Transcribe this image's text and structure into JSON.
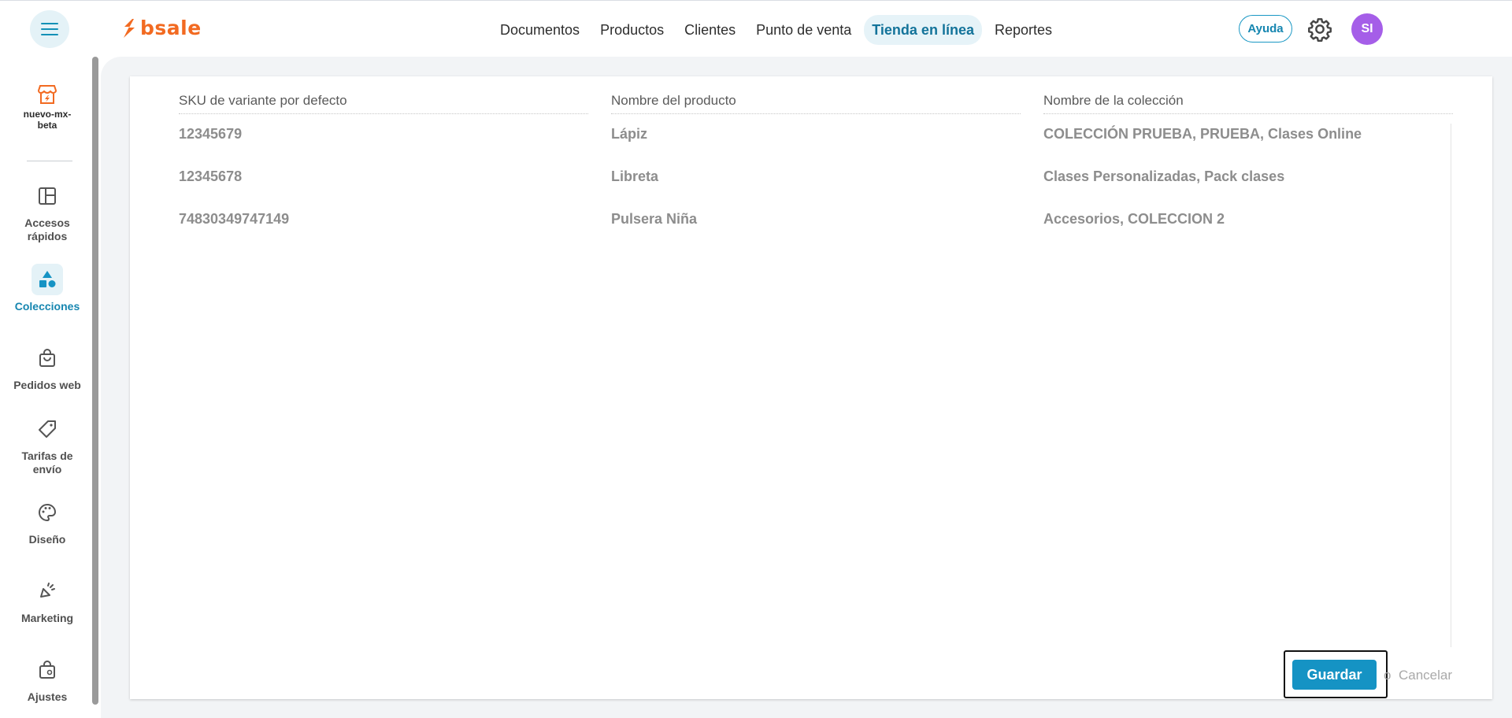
{
  "header": {
    "logo_text": "bsale",
    "nav": [
      {
        "label": "Documentos",
        "active": false
      },
      {
        "label": "Productos",
        "active": false
      },
      {
        "label": "Clientes",
        "active": false
      },
      {
        "label": "Punto de venta",
        "active": false
      },
      {
        "label": "Tienda en línea",
        "active": true
      },
      {
        "label": "Reportes",
        "active": false
      }
    ],
    "help_label": "Ayuda",
    "avatar_initials": "SI",
    "colors": {
      "brand": "#f26a21",
      "accent": "#1593c4",
      "avatar": "#a55ee8"
    }
  },
  "sidebar": {
    "store_name": "nuevo-mx-beta",
    "items": [
      {
        "label": "Accesos rápidos",
        "icon": "layout-icon",
        "active": false
      },
      {
        "label": "Colecciones",
        "icon": "shapes-icon",
        "active": true
      },
      {
        "label": "Pedidos web",
        "icon": "shopping-bag-icon",
        "active": false
      },
      {
        "label": "Tarifas de envío",
        "icon": "tag-icon",
        "active": false
      },
      {
        "label": "Diseño",
        "icon": "palette-icon",
        "active": false
      },
      {
        "label": "Marketing",
        "icon": "megaphone-icon",
        "active": false
      },
      {
        "label": "Ajustes",
        "icon": "bag-settings-icon",
        "active": false
      }
    ]
  },
  "table": {
    "columns": [
      "SKU de variante por defecto",
      "Nombre del producto",
      "Nombre de la colección"
    ],
    "rows": [
      [
        "12345679",
        "Lápiz",
        "COLECCIÓN PRUEBA, PRUEBA, Clases Online"
      ],
      [
        "12345678",
        "Libreta",
        "Clases Personalizadas, Pack clases"
      ],
      [
        "74830349747149",
        "Pulsera Niña",
        "Accesorios, COLECCION 2"
      ]
    ]
  },
  "actions": {
    "save_label": "Guardar",
    "or_label": "o",
    "cancel_label": "Cancelar"
  }
}
